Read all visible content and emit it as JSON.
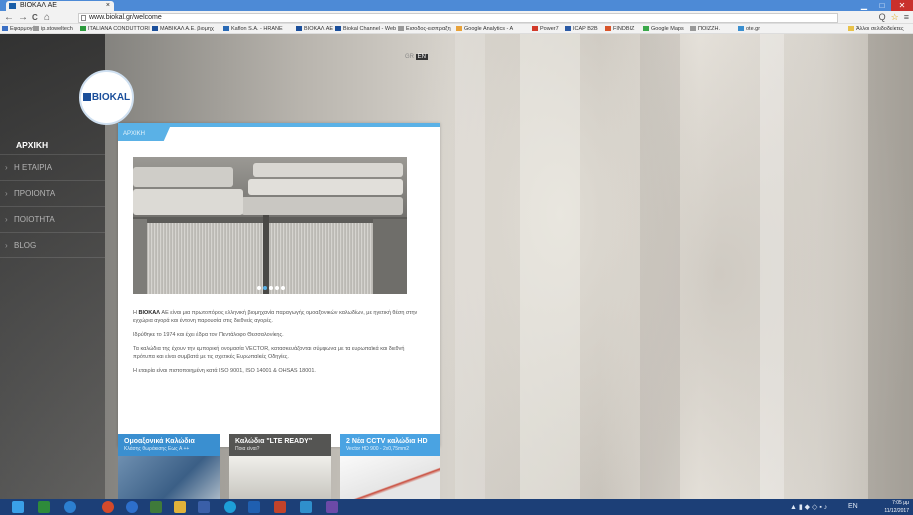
{
  "browser": {
    "tab_title": "BIOKAΛ AE",
    "tab_close": "×",
    "window_buttons": [
      "▁",
      "□",
      "✕"
    ],
    "nav": {
      "back": "←",
      "forward": "→",
      "reload": "C",
      "home": "⌂"
    },
    "url": "www.biokal.gr/welcome",
    "right_icons": [
      "Q",
      "☆",
      "≡"
    ],
    "bookmarks": [
      "Εφαρμογές",
      "ip.stoweltech",
      "ITALIANA CONDUTTORI",
      "ΜΑΒΙΚΑΛ Α.Ε. βιομηχ",
      "Kaflon S.A. - HRANE",
      "BIOKAΛ AE",
      "Biokal Channel - Web",
      "Εισοδος-εισπραξη",
      "Google Analytics - A",
      "Power7",
      "ICAP B2B",
      "FINDBIZ",
      "Google Maps",
      "ΠΟΙΖΖΗ.",
      "ote.gr",
      "Άλλοι σελιδοδείκτες"
    ]
  },
  "site": {
    "logo_text": "BIOKAL",
    "lang": {
      "gr": "GR",
      "en": "EN"
    },
    "menu": [
      {
        "label": "ΑΡΧΙΚΗ",
        "active": true
      },
      {
        "label": "Η ΕΤΑΙΡΙΑ",
        "active": false
      },
      {
        "label": "ΠΡΟΙΟΝΤΑ",
        "active": false
      },
      {
        "label": "ΠΟΙΟΤΗΤΑ",
        "active": false
      },
      {
        "label": "BLOG",
        "active": false
      }
    ],
    "menu_arrow": "›",
    "breadcrumb": "ΑΡΧΙΚΗ",
    "paragraphs": [
      {
        "brand": "BIOKAΛ",
        "text": " AE είναι μια πρωτοπόρος ελληνική βιομηχανία παραγωγής ομοαξονικών καλωδίων, με ηγετική θέση στην εγχώρια αγορά και έντονη παρουσία στις διεθνείς αγορές."
      },
      {
        "text": "Ιδρύθηκε το 1974 και έχει έδρα τον Πεντάλοφο Θεσσαλονίκης."
      },
      {
        "text": "Τα καλώδια της έχουν την εμπορική ονομασία VECTOR, κατασκευάζονται σύμφωνα με τα ευρωπαϊκά και διεθνή πρότυπα και είναι συμβατά με τις σχετικές Ευρωπαϊκές Οδηγίες."
      },
      {
        "text": "Η εταιρία είναι πιστοποιημένη κατά ISO 9001, ISO 14001 & OHSAS 18001."
      }
    ],
    "slider_count": 5,
    "slider_active": 1,
    "promos": [
      {
        "title": "Ομοαξονικά Καλώδια",
        "subtitle": "Κλάσης θωράκισης Εως A ++",
        "color": "#3a8fd0"
      },
      {
        "title": "Καλώδια \"LTE READY\"",
        "subtitle": "Ποια είναι?",
        "color": "#555553"
      },
      {
        "title": "2 Νέα CCTV καλώδια HD",
        "subtitle": "Vector HD 900 - 2x0,75mm2",
        "color": "#4aa3e2"
      }
    ]
  },
  "taskbar": {
    "time": "7:05 μμ",
    "date": "11/12/2017",
    "lang": "EN"
  },
  "colors": {
    "accent": "#5ab1e6",
    "brand": "#1b4f9b",
    "taskbar": "#1c3f77",
    "chrome_tabbar": "#4d8ad6"
  }
}
